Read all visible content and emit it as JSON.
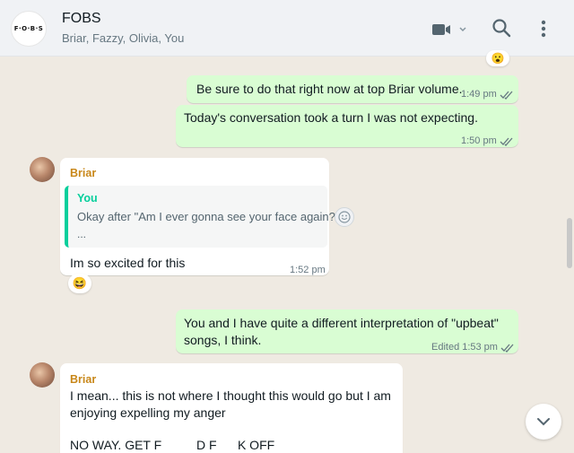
{
  "header": {
    "avatar_text": "F·O·B·S",
    "title": "FOBS",
    "members": "Briar, Fazzy, Olivia, You"
  },
  "messages": [
    {
      "type": "outgoing",
      "text": "Be sure to do that right now at top Briar volume.",
      "time": "1:49 pm"
    },
    {
      "type": "outgoing",
      "text": "Today's conversation took a turn I was not expecting.",
      "time": "1:50 pm"
    },
    {
      "type": "incoming",
      "sender": "Briar",
      "quote": {
        "author": "You",
        "text": "Okay after \"Am I ever gonna see your face again?\"",
        "more": "..."
      },
      "text": "Im so excited for this",
      "time": "1:52 pm",
      "reaction": "😆"
    },
    {
      "type": "outgoing",
      "lines": [
        "You and I have quite a different interpretation of \"upbeat\"",
        "songs, I think."
      ],
      "time": "1:53 pm",
      "edited_label": "Edited"
    },
    {
      "type": "incoming",
      "sender": "Briar",
      "lines": [
        "I mean... this is not where I thought this would go but I am",
        "enjoying expelling my anger"
      ],
      "line3": "NO WAY. GET F          D F      K OFF"
    }
  ],
  "colors": {
    "outgoing": "#d9fdd3",
    "incoming": "#ffffff",
    "sender": "#c88719",
    "quote_accent": "#06cf9c",
    "tick": "#667781"
  },
  "icons": [
    "video-call-icon",
    "search-icon",
    "menu-icon",
    "double-tick-icon",
    "emoji-icon",
    "chevron-down-icon"
  ]
}
